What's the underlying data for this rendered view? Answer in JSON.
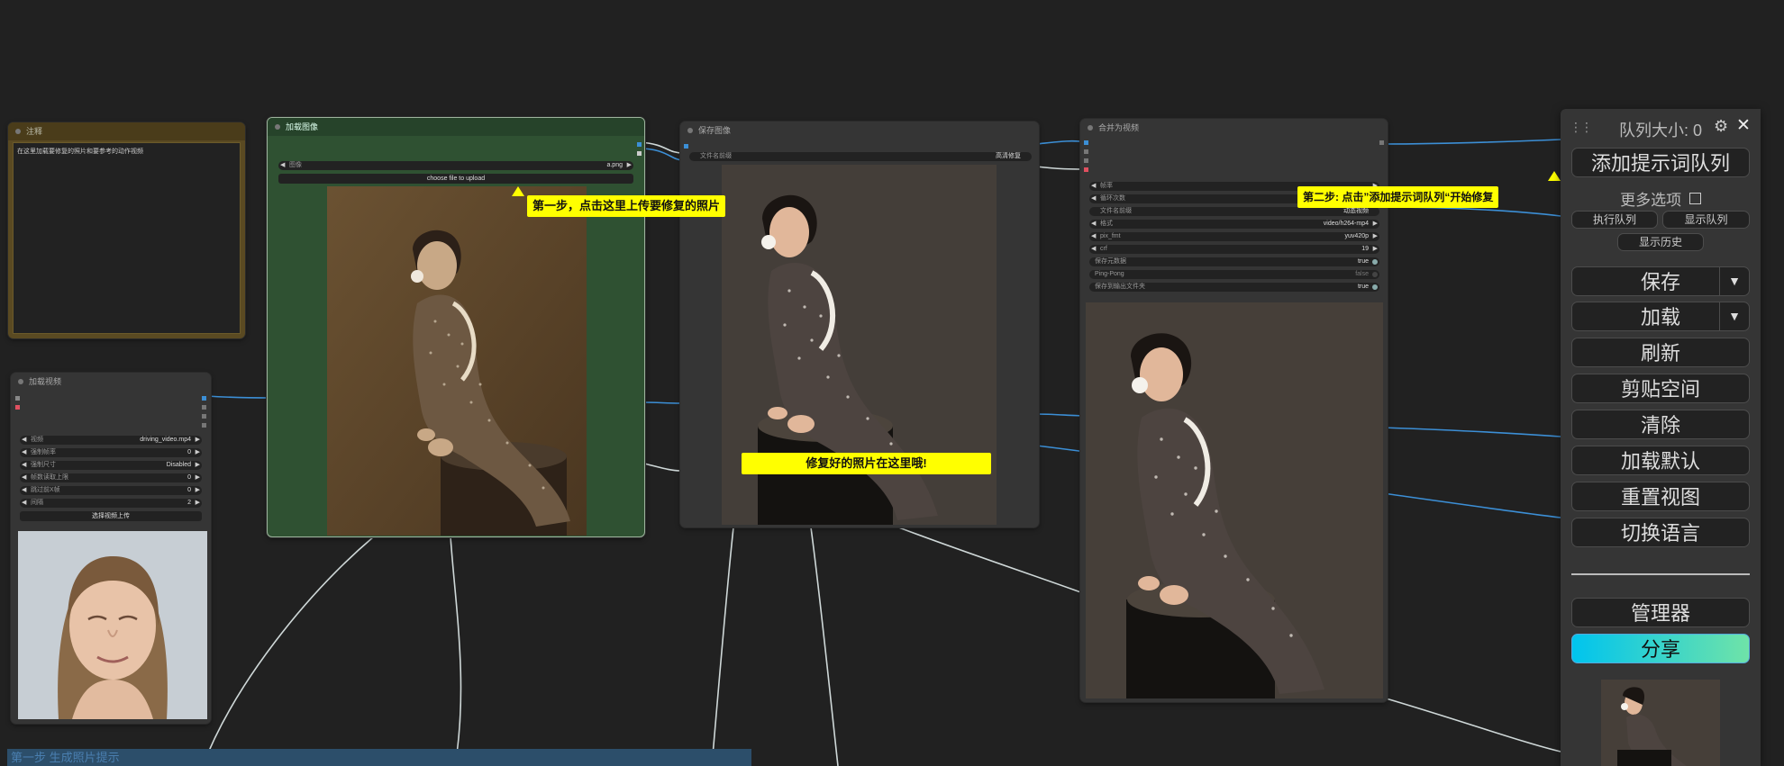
{
  "colors": {
    "canvas": "#212121",
    "node": "#353535",
    "callout": "#ffff00",
    "link_blue": "#3c8fd6",
    "link_white": "#cfd8d8"
  },
  "note_node": {
    "title": "注释",
    "text": "在这里加载要修复的照片和要参考的动作视频"
  },
  "load_video_node": {
    "title": "加载视频",
    "widgets": [
      {
        "label": "视频",
        "value": "driving_video.mp4"
      },
      {
        "label": "强制帧率",
        "value": "0"
      },
      {
        "label": "强制尺寸",
        "value": "Disabled"
      },
      {
        "label": "帧数读取上限",
        "value": "0"
      },
      {
        "label": "跳过前X帧",
        "value": "0"
      },
      {
        "label": "间隔",
        "value": "2"
      }
    ],
    "upload_button": "选择视频上传"
  },
  "load_image_node": {
    "title": "加载图像",
    "image_label": "图像",
    "image_value": "a.png",
    "upload_button": "choose file to upload"
  },
  "save_image_node": {
    "title": "保存图像",
    "filename_label": "文件名前缀",
    "filename_value": "高清修复"
  },
  "video_combine_node": {
    "title": "合并为视频",
    "widgets": [
      {
        "label": "帧率",
        "value": ""
      },
      {
        "label": "循环次数",
        "value": ""
      },
      {
        "label": "文件名前缀",
        "value": "动态视频"
      },
      {
        "label": "格式",
        "value": "video/h264-mp4"
      },
      {
        "label": "pix_fmt",
        "value": "yuv420p"
      },
      {
        "label": "crf",
        "value": "19"
      }
    ],
    "toggles": [
      {
        "label": "保存元数据",
        "value": "true"
      },
      {
        "label": "Ping-Pong",
        "value": "false"
      },
      {
        "label": "保存到输出文件夹",
        "value": "true"
      }
    ]
  },
  "callouts": {
    "step1": "第一步，点击这里上传要修复的照片",
    "step2": "第二步: 点击”添加提示词队列“开始修复",
    "result": "修复好的照片在这里哦!"
  },
  "group_label": "第一步 生成照片提示",
  "menu": {
    "queue_size": "队列大小: 0",
    "queue_prompt": "添加提示词队列",
    "extra_options": "更多选项",
    "view_queue": "执行队列",
    "view_history_short": "显示队列",
    "history": "显示历史",
    "save": "保存",
    "load": "加载",
    "refresh": "刷新",
    "clipspace": "剪贴空间",
    "clear": "清除",
    "load_default": "加载默认",
    "reset_view": "重置视图",
    "switch_language": "切换语言",
    "manager": "管理器",
    "share": "分享",
    "icons": [
      "drag-handle-icon",
      "gear-icon",
      "close-icon",
      "caret-down-icon"
    ]
  }
}
